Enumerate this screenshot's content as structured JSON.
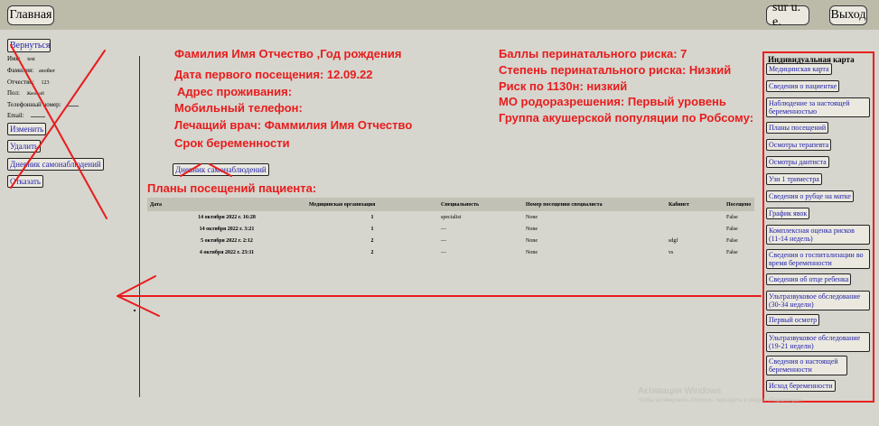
{
  "topbar": {
    "home": "Главная",
    "user": "sur u. e.",
    "logout": "Выход"
  },
  "sidebar": {
    "back": "Вернуться",
    "fields": [
      {
        "label": "Имя:",
        "value": "test"
      },
      {
        "label": "Фамилия:",
        "value": "another"
      },
      {
        "label": "Отчество:",
        "value": "123"
      },
      {
        "label": "Пол:",
        "value": "Женский"
      },
      {
        "label": "Телефонный номер:",
        "value": ""
      },
      {
        "label": "Email:",
        "value": ""
      }
    ],
    "edit": "Изменить",
    "delete": "Удалить",
    "diary": "Дневник самонаблюдений",
    "refuse": "Отказать"
  },
  "header_left": [
    "Фамилия Имя Отчество  ,Год рождения",
    "Дата первого посещения: 12.09.22",
    "Адрес проживания:",
    "Мобильный телефон:",
    "Лечащий врач: Фаммилия Имя Отчество",
    "Срок беременности"
  ],
  "header_right": [
    "Баллы перинатального риска: 7",
    "Степень перинатального риска: Низкий",
    "Риск по 1130н: низкий",
    "МО родоразрешения: Первый уровень",
    "Группа акушерской популяции по Робсому:"
  ],
  "main": {
    "diary_button": "Дневник самонаблюдений",
    "visits_title": "Планы посещений пациента:",
    "columns": [
      "Дата",
      "Медицинская организация",
      "Специальность",
      "Номер посещения специалиста",
      "Кабинет",
      "Посещено"
    ],
    "rows": [
      [
        "14 октября 2022 г. 16:28",
        "1",
        "specialist",
        "None",
        "",
        "False"
      ],
      [
        "14 октября 2022 г. 3:21",
        "1",
        "—",
        "None",
        "",
        "False"
      ],
      [
        "5 октября 2022 г. 2:12",
        "2",
        "—",
        "None",
        "sdgf",
        "False"
      ],
      [
        "4 октября 2022 г. 23:11",
        "2",
        "—",
        "None",
        "vs",
        "False"
      ]
    ]
  },
  "right_panel": {
    "title": "Индивидуальная карта",
    "items": [
      "Медицинская карта",
      "Сведения о пациентке",
      "Наблюдение за настоящей беременностью",
      "Планы посещений",
      "Осмотры терапевта",
      "Осмотры дантиста",
      "Узи 1 триместра",
      "Сведения о рубце на матке",
      "График явок",
      "Комплексная оценка рисков (11-14 недель)",
      "Сведения о госпитализации во время беременности",
      "Сведения об отце ребенка",
      "Ультразвуковое обследование (30-34 недели)",
      "Первый осмотр",
      "Ультразвуковое обследование (19-21 недели)",
      "Сведения о настоящей беременности",
      "Исход беременности"
    ]
  },
  "watermark": {
    "title": "Активация Windows",
    "subtitle": "Чтобы активировать Windows, перейдите в раздел «Параметры»."
  },
  "annotation_color": "#e81c1c"
}
